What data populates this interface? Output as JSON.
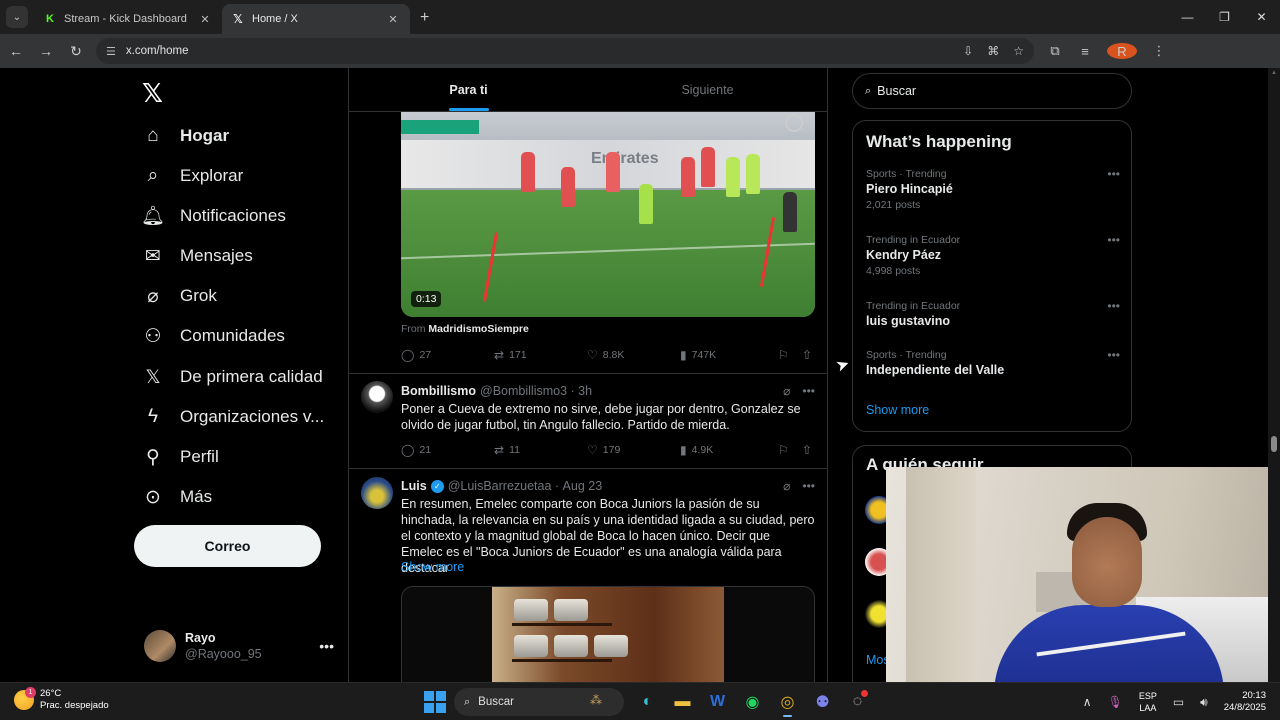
{
  "browser": {
    "tabs": [
      {
        "label": "Stream - Kick Dashboard",
        "favicon": "kick-icon",
        "active": false
      },
      {
        "label": "Home / X",
        "favicon": "x-icon",
        "active": true
      }
    ],
    "url": "x.com/home",
    "profile_initial": "R"
  },
  "leftnav": {
    "items": [
      {
        "label": "Hogar",
        "icon": "home-icon",
        "bold": true
      },
      {
        "label": "Explorar",
        "icon": "search-icon"
      },
      {
        "label": "Notificaciones",
        "icon": "bell-icon"
      },
      {
        "label": "Mensajes",
        "icon": "envelope-icon"
      },
      {
        "label": "Grok",
        "icon": "grok-icon"
      },
      {
        "label": "Comunidades",
        "icon": "communities-icon"
      },
      {
        "label": "De primera calidad",
        "icon": "x-premium-icon"
      },
      {
        "label": "Organizaciones v...",
        "icon": "lightning-icon"
      },
      {
        "label": "Perfil",
        "icon": "person-icon"
      },
      {
        "label": "Más",
        "icon": "more-circle-icon"
      }
    ],
    "post_button": "Correo",
    "profile": {
      "name": "Rayo",
      "handle": "@Rayooo_95"
    }
  },
  "feed": {
    "tabs": [
      {
        "label": "Para ti",
        "active": true
      },
      {
        "label": "Siguiente",
        "active": false
      }
    ],
    "video": {
      "duration": "0:13",
      "banner_text": "Emirates",
      "from_label": "From",
      "from_account": "MadridismoSiempre"
    },
    "tweet0_actions": {
      "replies": "27",
      "reposts": "171",
      "likes": "8.8K",
      "views": "747K"
    },
    "tweet1": {
      "name": "Bombillismo",
      "handle": "@Bombillismo3",
      "time": "3h",
      "text": "Poner a Cueva de extremo no sirve, debe jugar por dentro, Gonzalez se olvido de jugar futbol, tin Angulo fallecio. Partido de mierda.",
      "actions": {
        "replies": "21",
        "reposts": "11",
        "likes": "179",
        "views": "4.9K"
      }
    },
    "tweet2": {
      "name": "Luis",
      "handle": "@LuisBarrezuetaa",
      "time": "Aug 23",
      "text": "En resumen, Emelec comparte con Boca Juniors la pasión de su hinchada, la relevancia en su país y una identidad ligada a su ciudad, pero el contexto y la magnitud global de Boca lo hacen único. Decir que Emelec es el \"Boca Juniors de Ecuador\" es una analogía válida para destacar",
      "show_more": "Show more"
    }
  },
  "sidebar": {
    "search_placeholder": "Buscar",
    "whats_happening": {
      "title": "What’s happening",
      "trends": [
        {
          "meta": "Sports · Trending",
          "name": "Piero Hincapié",
          "posts": "2,021 posts"
        },
        {
          "meta": "Trending in Ecuador",
          "name": "Kendry Páez",
          "posts": "4,998 posts"
        },
        {
          "meta": "Trending in Ecuador",
          "name": "luis gustavino",
          "posts": ""
        },
        {
          "meta": "Sports · Trending",
          "name": "Independiente del Valle",
          "posts": ""
        }
      ],
      "show_more": "Show more"
    },
    "who_to_follow": {
      "title": "A quién seguir",
      "show_more": "Mos"
    }
  },
  "taskbar": {
    "weather_temp": "26°C",
    "weather_desc": "Prac. despejado",
    "weather_badge": "1",
    "search_label": "Buscar",
    "lang_line1": "ESP",
    "lang_line2": "LAA",
    "time": "20:13",
    "date": "24/8/2025"
  }
}
